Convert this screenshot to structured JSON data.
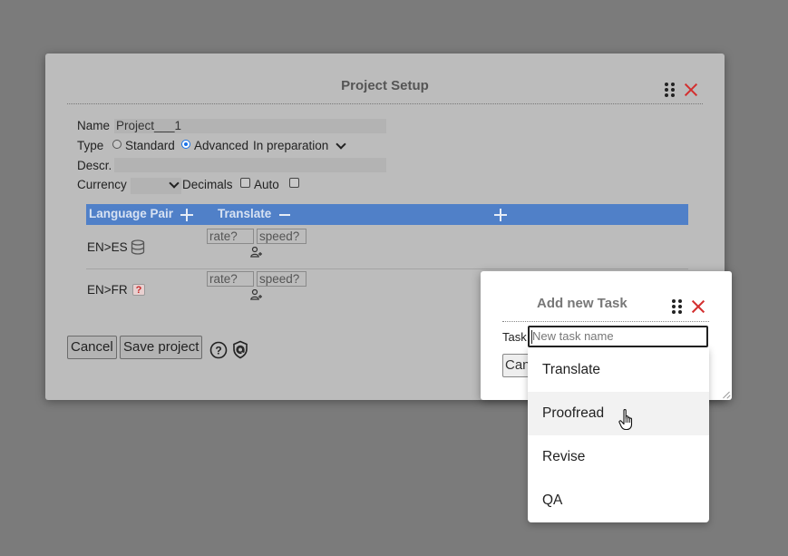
{
  "project_setup": {
    "title": "Project Setup",
    "form": {
      "name_label": "Name",
      "name_value": "Project___1",
      "type_label": "Type",
      "type_options": [
        "Standard",
        "Advanced"
      ],
      "type_selected": "Advanced",
      "status_value": "In preparation",
      "descr_label": "Descr.",
      "descr_value": "",
      "currency_label": "Currency",
      "currency_value": "",
      "decimals_label": "Decimals",
      "auto_label": "Auto"
    },
    "table": {
      "header": {
        "language_pair": "Language Pair",
        "task": "Translate"
      },
      "rows": [
        {
          "pair": "EN>ES",
          "icon": "database-icon",
          "rate_placeholder": "rate?",
          "speed_placeholder": "speed?"
        },
        {
          "pair": "EN>FR",
          "icon": "question-box-icon",
          "rate_placeholder": "rate?",
          "speed_placeholder": "speed?"
        }
      ]
    },
    "buttons": {
      "cancel": "Cancel",
      "save": "Save project"
    }
  },
  "add_task": {
    "title": "Add new Task",
    "task_label": "Task",
    "task_placeholder": "New task name",
    "cancel_label": "Can",
    "suggestions": [
      "Translate",
      "Proofread",
      "Revise",
      "QA"
    ],
    "hovered": "Proofread"
  },
  "colors": {
    "header_blue": "#5080c8",
    "close_red": "#d32f2f",
    "overlay": "#7b7b7b"
  }
}
